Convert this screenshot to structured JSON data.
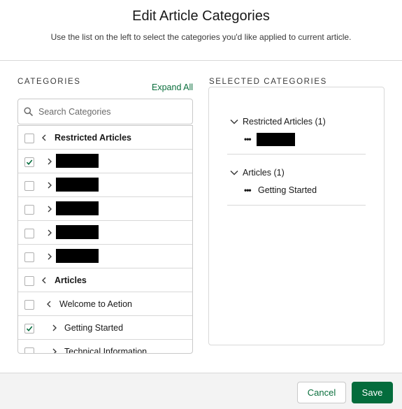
{
  "modal": {
    "title": "Edit Article Categories",
    "subtitle": "Use the list on the left to select the categories you'd like applied to current article."
  },
  "left": {
    "heading": "CATEGORIES",
    "expand_all": "Expand All",
    "search_placeholder": "Search Categories",
    "rows": [
      {
        "label": "Restricted Articles",
        "bold": true,
        "checked": false,
        "expanded": true,
        "redacted": false
      },
      {
        "label": "",
        "bold": false,
        "checked": true,
        "expanded": false,
        "redacted": true
      },
      {
        "label": "",
        "bold": false,
        "checked": false,
        "expanded": false,
        "redacted": true
      },
      {
        "label": "",
        "bold": false,
        "checked": false,
        "expanded": false,
        "redacted": true
      },
      {
        "label": "",
        "bold": false,
        "checked": false,
        "expanded": false,
        "redacted": true
      },
      {
        "label": "",
        "bold": false,
        "checked": false,
        "expanded": false,
        "redacted": true
      },
      {
        "label": "Articles",
        "bold": true,
        "checked": false,
        "expanded": true,
        "redacted": false
      },
      {
        "label": "Welcome to Aetion",
        "bold": false,
        "checked": false,
        "expanded": true,
        "redacted": false
      },
      {
        "label": "Getting Started",
        "bold": false,
        "checked": true,
        "expanded": false,
        "redacted": false
      },
      {
        "label": "Technical Information",
        "bold": false,
        "checked": false,
        "expanded": false,
        "redacted": false
      }
    ]
  },
  "right": {
    "heading": "SELECTED CATEGORIES",
    "groups": [
      {
        "label": "Restricted Articles (1)",
        "items": [
          {
            "label": "",
            "redacted": true
          }
        ]
      },
      {
        "label": "Articles (1)",
        "items": [
          {
            "label": "Getting Started",
            "redacted": false
          }
        ]
      }
    ]
  },
  "footer": {
    "cancel": "Cancel",
    "save": "Save"
  },
  "colors": {
    "accent": "#046c3c",
    "link": "#0a6e3c",
    "border": "#c9c9c9",
    "footer_bg": "#f3f3f3"
  }
}
